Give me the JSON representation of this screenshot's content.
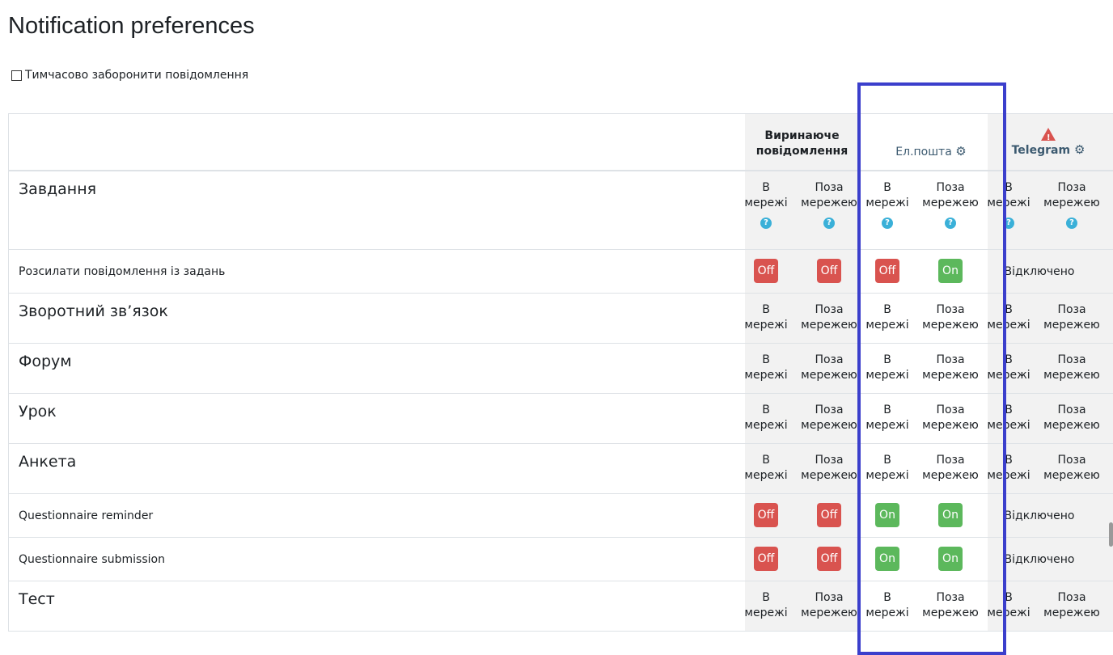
{
  "page": {
    "title": "Notification preferences"
  },
  "disable_notifications": {
    "label": "Тимчасово заборонити повідомлення"
  },
  "processors": {
    "popup": {
      "line1": "Виринаюче",
      "line2": "повідомлення"
    },
    "email": {
      "label": "Ел.пошта",
      "icon": "gear-icon"
    },
    "telegram": {
      "label": "Telegram",
      "icon": "gear-icon",
      "warning_icon": "warning-icon",
      "warning_color": "#d9534f"
    }
  },
  "states": {
    "online_1": "В",
    "online_2": "мережі",
    "offline_1": "Поза",
    "offline_2": "мережею",
    "help": "?"
  },
  "toggle_labels": {
    "on": "On",
    "off": "Off"
  },
  "disabled_text": "Відключено",
  "colors": {
    "on": "#5cb85c",
    "off": "#d9534f",
    "highlight": "#3b3fcc",
    "help": "#3ab0d8"
  },
  "rows": [
    {
      "kind": "component",
      "name": "Завдання",
      "help": true
    },
    {
      "kind": "setting",
      "name": "Розсилати повідомлення із задань",
      "popup_online": "Off",
      "popup_offline": "Off",
      "email_online": "Off",
      "email_offline": "On",
      "telegram": "Відключено"
    },
    {
      "kind": "component",
      "name": "Зворотний зв’язок"
    },
    {
      "kind": "component",
      "name": "Форум"
    },
    {
      "kind": "component",
      "name": "Урок"
    },
    {
      "kind": "component",
      "name": "Анкета"
    },
    {
      "kind": "setting",
      "name": "Questionnaire reminder",
      "popup_online": "Off",
      "popup_offline": "Off",
      "email_online": "On",
      "email_offline": "On",
      "telegram": "Відключено"
    },
    {
      "kind": "setting",
      "name": "Questionnaire submission",
      "popup_online": "Off",
      "popup_offline": "Off",
      "email_online": "On",
      "email_offline": "On",
      "telegram": "Відключено"
    },
    {
      "kind": "component",
      "name": "Тест"
    }
  ]
}
